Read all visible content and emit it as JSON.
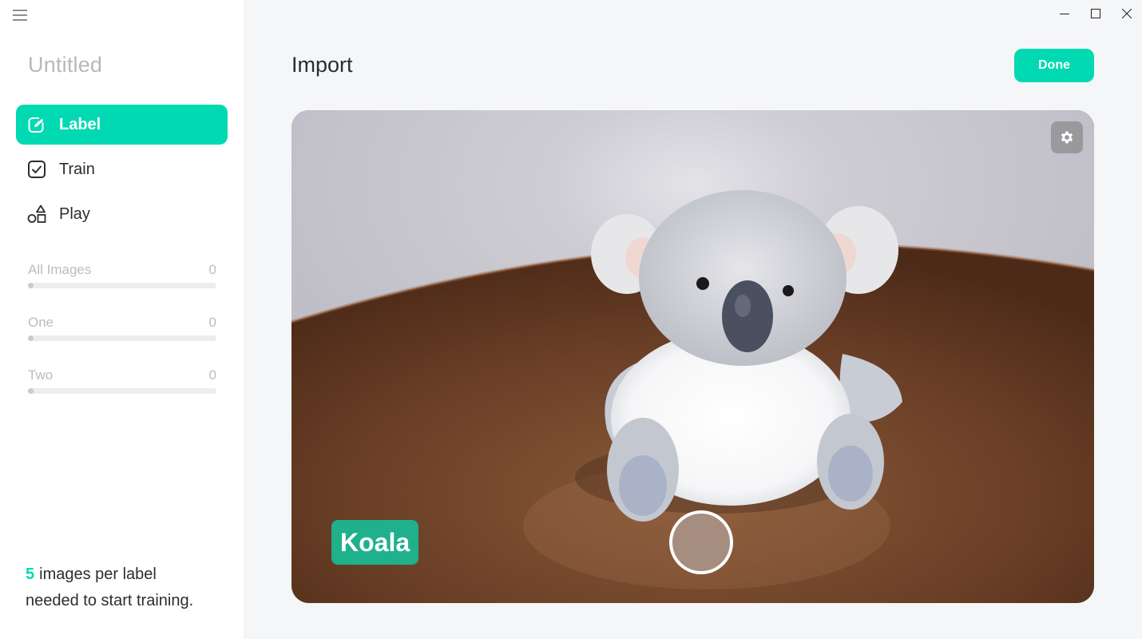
{
  "window": {
    "controls": [
      "minimize-icon",
      "maximize-icon",
      "close-icon"
    ]
  },
  "sidebar": {
    "menu_icon": "hamburger-icon",
    "project_title": "Untitled",
    "nav": [
      {
        "label": "Label",
        "icon": "pencil-square-icon",
        "active": true
      },
      {
        "label": "Train",
        "icon": "checkbox-icon",
        "active": false
      },
      {
        "label": "Play",
        "icon": "shapes-icon",
        "active": false
      }
    ],
    "classes": [
      {
        "name": "All Images",
        "count": "0"
      },
      {
        "name": "One",
        "count": "0"
      },
      {
        "name": "Two",
        "count": "0"
      }
    ],
    "hint": {
      "count": "5",
      "line1": "images per label",
      "line2": "needed to start training."
    }
  },
  "main": {
    "title": "Import",
    "done_label": "Done",
    "camera": {
      "label_chip": "Koala",
      "settings_icon": "gear-icon",
      "shutter": "capture-button"
    }
  },
  "colors": {
    "accent": "#00d9b1",
    "chip": "#1fb08c"
  }
}
